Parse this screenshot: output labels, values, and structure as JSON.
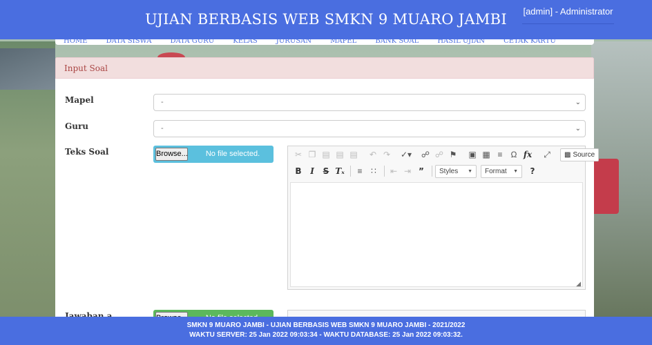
{
  "header": {
    "title": "UJIAN BERBASIS WEB SMKN 9 MUARO JAMBI",
    "user": "[admin] - Administrator"
  },
  "nav": {
    "items": [
      "HOME",
      "DATA SISWA",
      "DATA GURU",
      "KELAS",
      "JURUSAN",
      "MAPEL",
      "BANK SOAL",
      "HASIL UJIAN",
      "CETAK KARTU"
    ]
  },
  "panel": {
    "title": "Input Soal",
    "mapel_label": "Mapel",
    "mapel_value": "-",
    "guru_label": "Guru",
    "guru_value": "-",
    "teks_soal_label": "Teks Soal",
    "jawaban_label": "Jawaban a",
    "browse_label": "Browse...",
    "no_file_text": "No file selected."
  },
  "editor": {
    "styles_label": "Styles",
    "format_label": "Format",
    "source_label": "Source",
    "help_label": "?"
  },
  "footer": {
    "line1": "SMKN 9 MUARO JAMBI - UJIAN BERBASIS WEB SMKN 9 MUARO JAMBI - 2021/2022",
    "line2": "WAKTU SERVER: 25 Jan 2022 09:03:34 - WAKTU DATABASE: 25 Jan 2022 09:03:32."
  },
  "colors": {
    "primary": "#4a6ee0",
    "panel_header_bg": "#f2dede",
    "panel_header_text": "#a94442",
    "file_info": "#5bc0de",
    "file_success": "#5cb85c"
  }
}
